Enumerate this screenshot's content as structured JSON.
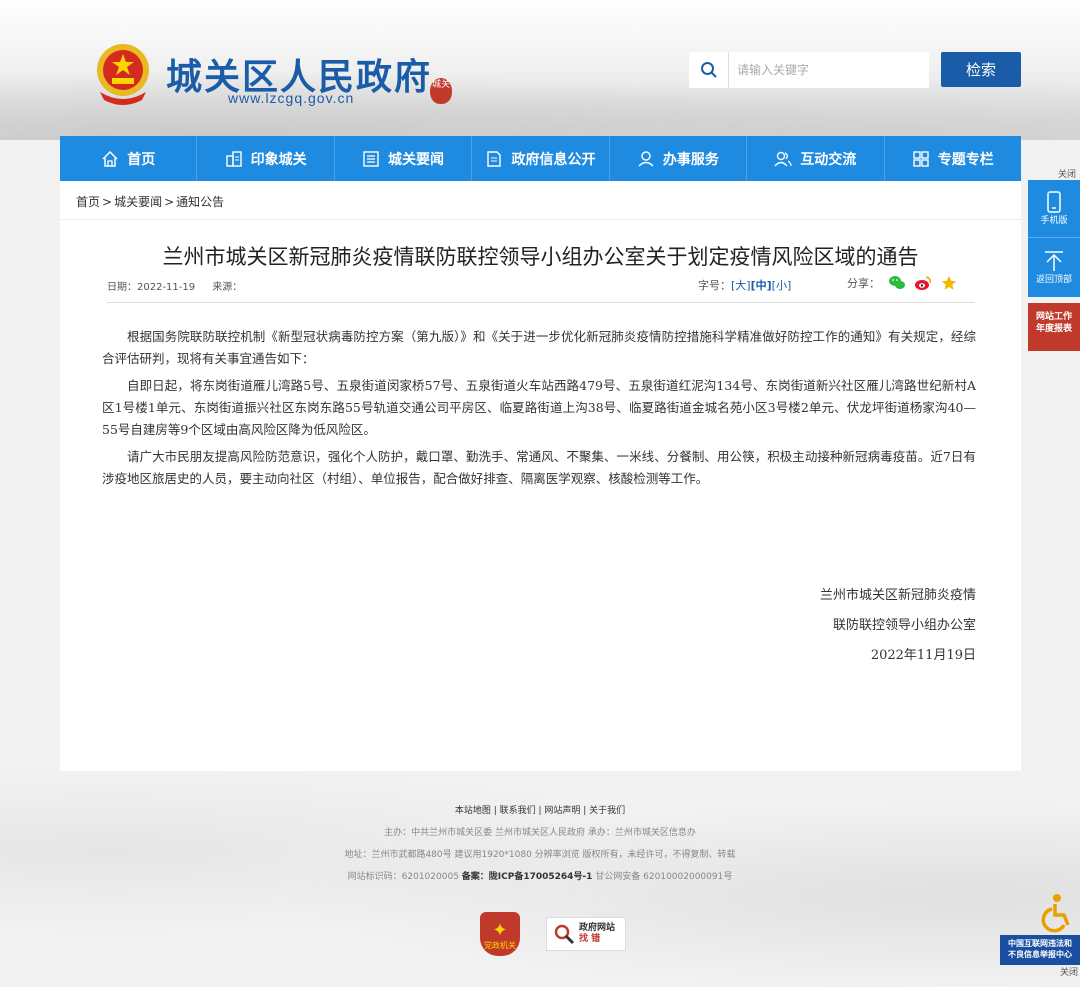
{
  "header": {
    "site_title": "城关区人民政府",
    "site_url": "www.lzcgq.gov.cn",
    "seal_text": "城关",
    "search_placeholder": "请输入关键字",
    "search_button": "检索"
  },
  "nav": {
    "items": [
      {
        "label": "首页",
        "icon": "home-icon"
      },
      {
        "label": "印象城关",
        "icon": "impression-icon"
      },
      {
        "label": "城关要闻",
        "icon": "news-icon"
      },
      {
        "label": "政府信息公开",
        "icon": "document-icon"
      },
      {
        "label": "办事服务",
        "icon": "service-icon"
      },
      {
        "label": "互动交流",
        "icon": "people-icon"
      },
      {
        "label": "专题专栏",
        "icon": "grid-icon"
      }
    ]
  },
  "breadcrumb": {
    "home": "首页",
    "level1": "城关要闻",
    "level2": "通知公告",
    "sep": ">"
  },
  "article": {
    "title": "兰州市城关区新冠肺炎疫情联防联控领导小组办公室关于划定疫情风险区域的通告",
    "date_label": "日期：2022-11-19",
    "source_label": "来源：",
    "fontsize_label": "字号：",
    "fontsize_large": "[大]",
    "fontsize_medium": "[中]",
    "fontsize_small": "[小]",
    "share_label": "分享：",
    "paragraphs": [
      "根据国务院联防联控机制《新型冠状病毒防控方案（第九版）》和《关于进一步优化新冠肺炎疫情防控措施科学精准做好防控工作的通知》有关规定，经综合评估研判，现将有关事宜通告如下：",
      "自即日起，将东岗街道雁儿湾路5号、五泉街道闵家桥57号、五泉街道火车站西路479号、五泉街道红泥沟134号、东岗街道新兴社区雁儿湾路世纪新村A区1号楼1单元、东岗街道振兴社区东岗东路55号轨道交通公司平房区、临夏路街道上沟38号、临夏路街道金城名苑小区3号楼2单元、伏龙坪街道杨家沟40—55号自建房等9个区域由高风险区降为低风险区。",
      "请广大市民朋友提高风险防范意识，强化个人防护，戴口罩、勤洗手、常通风、不聚集、一米线、分餐制、用公筷，积极主动接种新冠病毒疫苗。近7日有涉疫地区旅居史的人员，要主动向社区（村组）、单位报告，配合做好排查、隔离医学观察、核酸检测等工作。"
    ],
    "sign_line1": "兰州市城关区新冠肺炎疫情",
    "sign_line2": "联防联控领导小组办公室",
    "sign_date": "2022年11月19日"
  },
  "footer": {
    "links": "本站地图 | 联系我们 | 网站声明 | 关于我们",
    "line1": "主办：中共兰州市城关区委 兰州市城关区人民政府 承办：兰州市城关区信息办",
    "line2": "地址：兰州市武都路480号 建议用1920*1080 分辨率浏览 版权所有，未经许可，不得复制、转载",
    "line3_prefix": "网站标识码：6201020005 ",
    "line3_bold": "备案：",
    "line3_icp": "陇ICP备17005264号-1",
    "line3_suffix": " 甘公网安备 62010002000091号",
    "badge_party_text": "党政机关",
    "badge_error_line1": "政府网站",
    "badge_error_line2": "找 错"
  },
  "float": {
    "close_label": "关闭",
    "mobile_label": "手机版",
    "top_label": "返回顶部",
    "report_line1": "网站工作",
    "report_line2": "年度报表",
    "report_center_line1": "中国互联网违法和",
    "report_center_line2": "不良信息举报中心"
  },
  "colors": {
    "primary": "#1e8ae0",
    "brand": "#1a5ca8",
    "accent_red": "#c0392b"
  }
}
